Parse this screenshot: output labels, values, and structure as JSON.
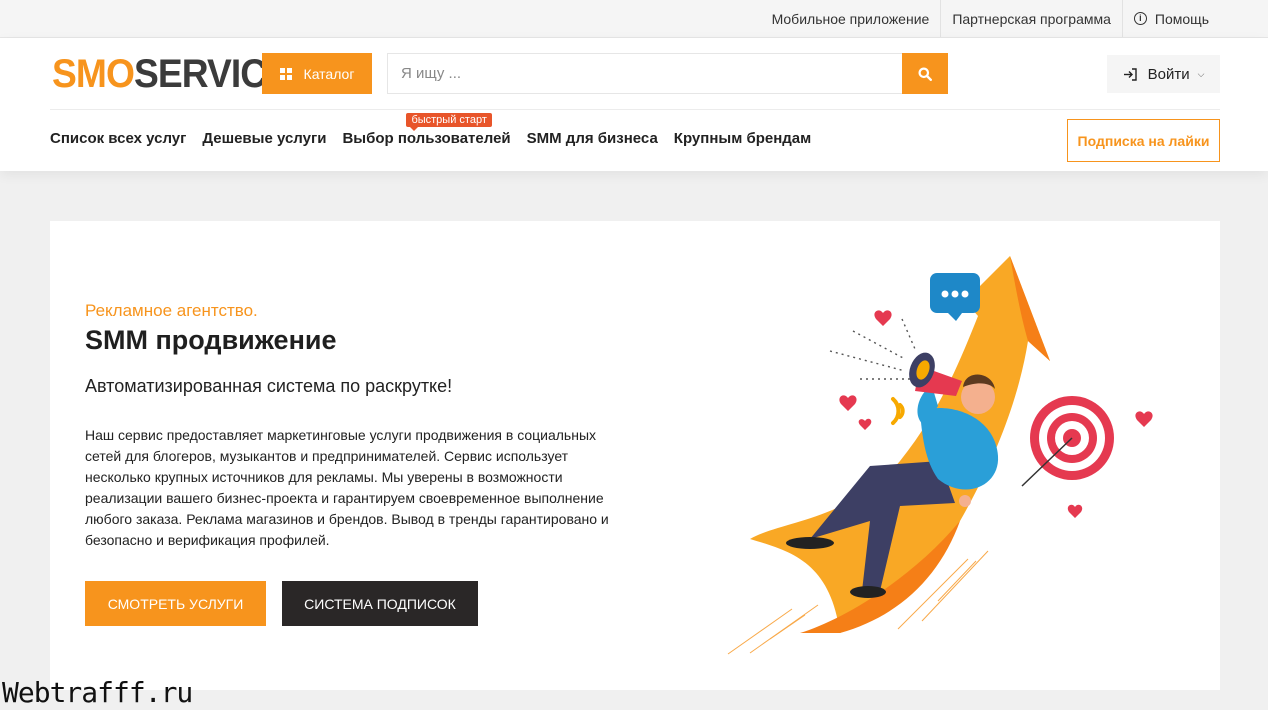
{
  "topbar": {
    "links": [
      "Мобильное приложение",
      "Партнерская программа"
    ],
    "help": "Помощь"
  },
  "header": {
    "logo_part1": "SMO",
    "logo_part2": "SERVICE",
    "catalog_label": "Каталог",
    "search_placeholder": "Я ищу ...",
    "login_label": "Войти"
  },
  "nav": {
    "items": [
      "Список всех услуг",
      "Дешевые услуги",
      "Выбор пользователей",
      "SMM для бизнеса",
      "Крупным брендам"
    ],
    "badge": "быстрый старт",
    "subscribe_label": "Подписка на лайки"
  },
  "hero": {
    "eyebrow": "Рекламное агентство.",
    "title": "SMM продвижение",
    "lead": "Автоматизированная система по раскрутке!",
    "description": "Наш сервис предоставляет маркетинговые услуги продвижения в социальных сетей для блогеров, музыкантов и предпринимателей. Сервис использует несколько крупных источников для рекламы. Мы уверены в возможности реализации вашего бизнес-проекта и гарантируем своевременное выполнение любого заказа. Реклама магазинов и брендов. Вывод в тренды гарантировано и безопасно и верификация профилей.",
    "button_primary": "СМОТРЕТЬ УСЛУГИ",
    "button_secondary": "СИСТЕМА ПОДПИСОК"
  },
  "watermark": "Webtrafff.ru",
  "colors": {
    "accent": "#f7941d",
    "dark_button": "#2a2727",
    "badge": "#e8552a"
  }
}
